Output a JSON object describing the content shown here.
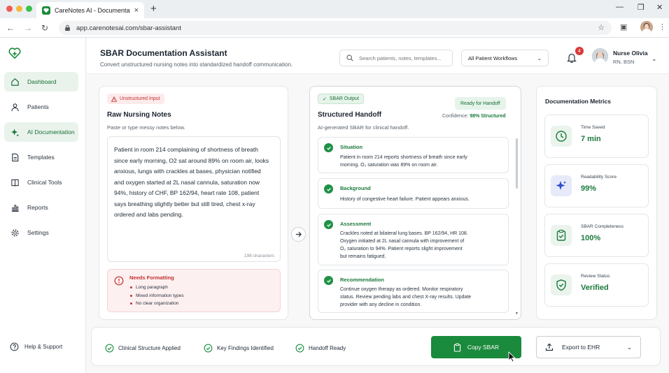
{
  "browser": {
    "tab_title": "CareNotes AI - Documentation",
    "url": "app.carenotesai.com/sbar-assistant"
  },
  "sidebar": {
    "items": [
      {
        "label": "Dashboard",
        "icon": "home-icon"
      },
      {
        "label": "Patients",
        "icon": "user-icon"
      },
      {
        "label": "AI Documentation",
        "icon": "sparkle-icon"
      },
      {
        "label": "Templates",
        "icon": "document-icon"
      },
      {
        "label": "Clinical Tools",
        "icon": "book-icon"
      },
      {
        "label": "Reports",
        "icon": "bar-chart-icon"
      },
      {
        "label": "Settings",
        "icon": "gear-icon"
      }
    ],
    "help": "Help & Support"
  },
  "header": {
    "title": "SBAR Documentation Assistant",
    "subtitle": "Convert unstructured nursing notes into standardized handoff communication.",
    "search_placeholder": "Search patients, notes, templates...",
    "workflow": "All Patient Workflows",
    "notification_count": "4",
    "user_name": "Nurse Olivia",
    "user_role": "RN, BSN"
  },
  "input": {
    "badge": "Unstructured Input",
    "title": "Raw Nursing Notes",
    "subtitle": "Paste or type messy notes below.",
    "notes": "Patient in room 214 complaining of shortness of breath since early morning, O2 sat around 89% on room air, looks anxious, lungs with crackles at bases, physician notified and oxygen started at 2L nasal cannula, saturation now 94%, history of CHF, BP 162/94, heart rate 108, patient says breathing slightly better but still tired, chest x-ray ordered and labs pending.",
    "char_count": "198 characters",
    "warning_title": "Needs Formatting",
    "warning_items": [
      "Long paragraph",
      "Mixed information types",
      "No clear organization"
    ]
  },
  "output": {
    "badge": "SBAR Output",
    "status": "Ready for Handoff",
    "title": "Structured Handoff",
    "subtitle": "AI-generated SBAR for clinical handoff.",
    "confidence_label": "Confidence:",
    "confidence_value": "98% Structured",
    "sections": [
      {
        "title": "Situation",
        "line1": "Patient in room 214 reports shortness of breath since early",
        "line2": "morning. O₂ saturation was 89% on room air.",
        "line3": "",
        "line4": ""
      },
      {
        "title": "Background",
        "line1": "History of congestive heart failure. Patient appears anxious.",
        "line2": "",
        "line3": "",
        "line4": ""
      },
      {
        "title": "Assessment",
        "line1": "Crackles noted at bilateral lung bases. BP 162/94, HR 108.",
        "line2": "Oxygen initiated at 2L nasal cannula with improvement of",
        "line3": "O₂ saturation to 94%. Patient reports slight improvement",
        "line4": "but remains fatigued."
      },
      {
        "title": "Recommendation",
        "line1": "Continue oxygen therapy as ordered. Monitor respiratory",
        "line2": "status. Review pending labs and chest X-ray results. Update",
        "line3": "provider with any decline in condition.",
        "line4": ""
      }
    ]
  },
  "metrics": {
    "title": "Documentation Metrics",
    "items": [
      {
        "label": "Time Saved",
        "value": "7 min",
        "icon": "clock-icon"
      },
      {
        "label": "Readability Score",
        "value": "99%",
        "icon": "sparkle-icon"
      },
      {
        "label": "SBAR Completeness",
        "value": "100%",
        "icon": "clipboard-check-icon"
      },
      {
        "label": "Review Status",
        "value": "Verified",
        "icon": "shield-check-icon"
      }
    ]
  },
  "footer": {
    "checks": [
      "Clinical Structure Applied",
      "Key Findings Identified",
      "Handoff Ready"
    ],
    "copy_label": "Copy SBAR",
    "export_label": "Export to EHR"
  },
  "colors": {
    "accent": "#1a8a3c",
    "warning": "#c23131",
    "badge": "#d93a3a"
  }
}
